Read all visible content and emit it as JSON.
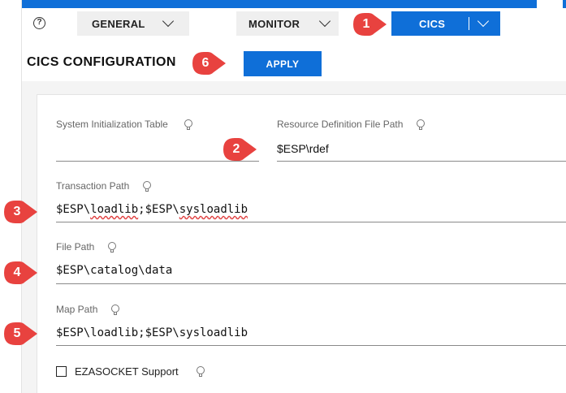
{
  "tabs": {
    "help_icon": "question-circle-icon",
    "general": "GENERAL",
    "monitor": "MONITOR",
    "cics": "CICS"
  },
  "header": {
    "title": "CICS CONFIGURATION",
    "apply_label": "APPLY"
  },
  "fields": {
    "sit_label": "System Initialization Table",
    "sit_value": "",
    "rdef_label": "Resource Definition File Path",
    "rdef_value": "$ESP\\rdef",
    "transaction_label": "Transaction Path",
    "transaction_value_a": "$ESP\\",
    "transaction_value_b": "loadlib",
    "transaction_value_c": ";$ESP\\",
    "transaction_value_d": "sysloadlib",
    "file_label": "File Path",
    "file_value": "$ESP\\catalog\\data",
    "map_label": "Map Path",
    "map_value": "$ESP\\loadlib;$ESP\\sysloadlib",
    "ezasocket_label": "EZASOCKET Support",
    "ezasocket_checked": false
  },
  "callouts": [
    "1",
    "2",
    "3",
    "4",
    "5",
    "6"
  ],
  "colors": {
    "accent": "#0f6fd8",
    "callout": "#e8423f"
  }
}
